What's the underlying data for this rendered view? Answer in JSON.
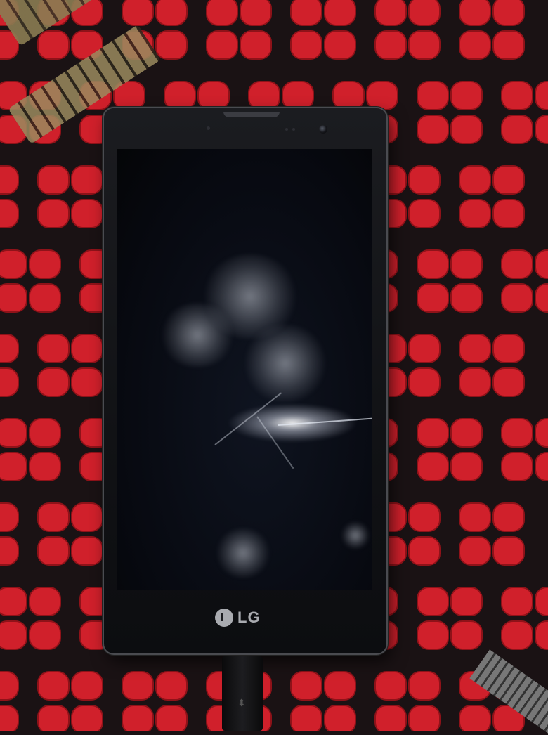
{
  "scene": {
    "description_free": true,
    "fabric_colors": {
      "background": "#1a1214",
      "petal": "#d0202b",
      "petal_dark": "#8f1219"
    }
  },
  "phone": {
    "brand": "LG",
    "brand_color": "#a9abb0",
    "screen_state": "off"
  },
  "icons": {
    "logo": "lg-logo-icon",
    "camera": "front-camera-icon",
    "usb": "usb-icon"
  }
}
